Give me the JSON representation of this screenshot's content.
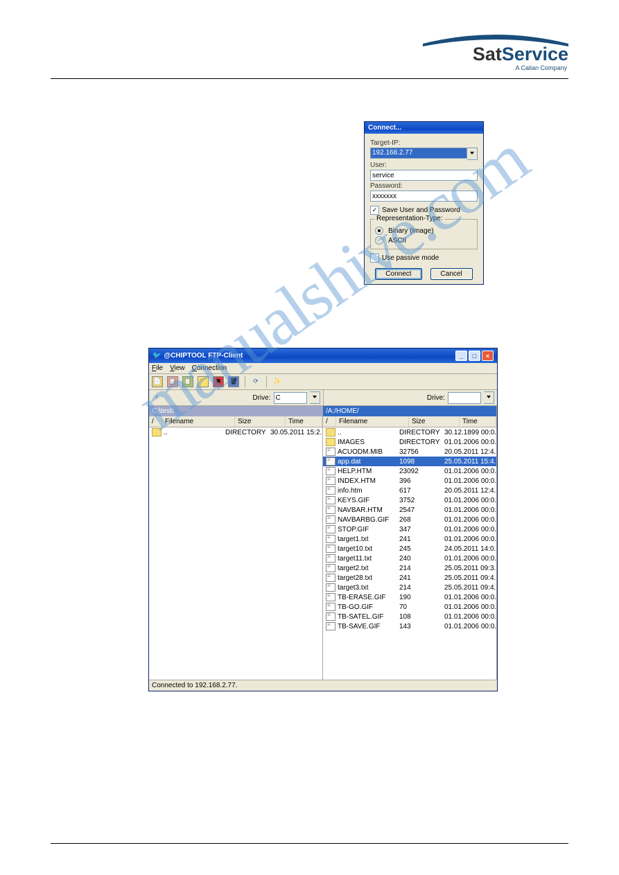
{
  "logo": {
    "brand1": "Sat",
    "brand2": "Service",
    "sub": "A Calian Company"
  },
  "watermark": "manualshive.com",
  "connect": {
    "title": "Connect...",
    "ip_label": "Target-IP:",
    "ip": "192.168.2.77",
    "user_label": "User:",
    "user": "service",
    "pwd_label": "Password:",
    "pwd": "xxxxxxx",
    "save_label": "Save User and Password",
    "save": true,
    "rep_title": "Representation-Type:",
    "rep_binary": "Binary (Image)",
    "rep_ascii": "ASCII",
    "rep_sel": "binary",
    "passive_label": "Use passive mode",
    "passive": false,
    "connect_btn": "Connect",
    "cancel_btn": "Cancel"
  },
  "ftp": {
    "title": "@CHIPTOOL FTP-Client",
    "menu": {
      "file": "File",
      "view": "View",
      "conn": "Connection"
    },
    "drive_label": "Drive:",
    "drive_left": "C",
    "drive_right": "",
    "path_left": "C:\\test\\",
    "path_right": "/A:/HOME/",
    "headers": {
      "name": "Filename",
      "size": "Size",
      "time": "Time",
      "sort": "/"
    },
    "left": [
      {
        "name": "..",
        "size": "DIRECTORY",
        "time": "30.05.2011 15:2..",
        "type": "folder"
      }
    ],
    "right": [
      {
        "name": "..",
        "size": "DIRECTORY",
        "time": "30.12.1899 00:0..",
        "type": "folder"
      },
      {
        "name": "IMAGES",
        "size": "DIRECTORY",
        "time": "01.01.2006 00:0..",
        "type": "folder"
      },
      {
        "name": "ACUODM.MIB",
        "size": "32756",
        "time": "20.05.2011 12:4..",
        "type": "file"
      },
      {
        "name": "app.dat",
        "size": "1098",
        "time": "25.05.2011 15:4..",
        "type": "file",
        "selected": true
      },
      {
        "name": "HELP.HTM",
        "size": "23092",
        "time": "01.01.2006 00:0..",
        "type": "file"
      },
      {
        "name": "INDEX.HTM",
        "size": "396",
        "time": "01.01.2006 00:0..",
        "type": "file"
      },
      {
        "name": "info.htm",
        "size": "617",
        "time": "20.05.2011 12:4..",
        "type": "file"
      },
      {
        "name": "KEYS.GIF",
        "size": "3752",
        "time": "01.01.2006 00:0..",
        "type": "file"
      },
      {
        "name": "NAVBAR.HTM",
        "size": "2547",
        "time": "01.01.2006 00:0..",
        "type": "file"
      },
      {
        "name": "NAVBARBG.GIF",
        "size": "268",
        "time": "01.01.2006 00:0..",
        "type": "file"
      },
      {
        "name": "STOP.GIF",
        "size": "347",
        "time": "01.01.2006 00:0..",
        "type": "file"
      },
      {
        "name": "target1.txt",
        "size": "241",
        "time": "01.01.2006 00:0..",
        "type": "file"
      },
      {
        "name": "target10.txt",
        "size": "245",
        "time": "24.05.2011 14:0..",
        "type": "file"
      },
      {
        "name": "target11.txt",
        "size": "240",
        "time": "01.01.2006 00:0..",
        "type": "file"
      },
      {
        "name": "target2.txt",
        "size": "214",
        "time": "25.05.2011 09:3..",
        "type": "file"
      },
      {
        "name": "target28.txt",
        "size": "241",
        "time": "25.05.2011 09:4..",
        "type": "file"
      },
      {
        "name": "target3.txt",
        "size": "214",
        "time": "25.05.2011 09:4..",
        "type": "file"
      },
      {
        "name": "TB-ERASE.GIF",
        "size": "190",
        "time": "01.01.2006 00:0..",
        "type": "file"
      },
      {
        "name": "TB-GO.GIF",
        "size": "70",
        "time": "01.01.2006 00:0..",
        "type": "file"
      },
      {
        "name": "TB-SATEL.GIF",
        "size": "108",
        "time": "01.01.2006 00:0..",
        "type": "file"
      },
      {
        "name": "TB-SAVE.GIF",
        "size": "143",
        "time": "01.01.2006 00:0..",
        "type": "file"
      }
    ],
    "status": "Connected to 192.168.2.77."
  }
}
